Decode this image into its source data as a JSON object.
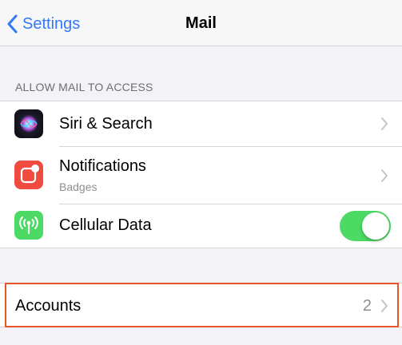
{
  "navbar": {
    "back_label": "Settings",
    "title": "Mail"
  },
  "section": {
    "header": "ALLOW MAIL TO ACCESS"
  },
  "rows": [
    {
      "label": "Siri & Search",
      "icon": "siri-icon"
    },
    {
      "label": "Notifications",
      "sublabel": "Badges",
      "icon": "notifications-icon",
      "icon_color": "#ef4b3f"
    },
    {
      "label": "Cellular Data",
      "icon": "cellular-icon",
      "icon_color": "#4cd964",
      "toggle_on": true
    }
  ],
  "accounts": {
    "label": "Accounts",
    "count": "2"
  },
  "colors": {
    "accent": "#3478f6",
    "toggle_on": "#4cd964",
    "highlight": "#e8532b"
  }
}
